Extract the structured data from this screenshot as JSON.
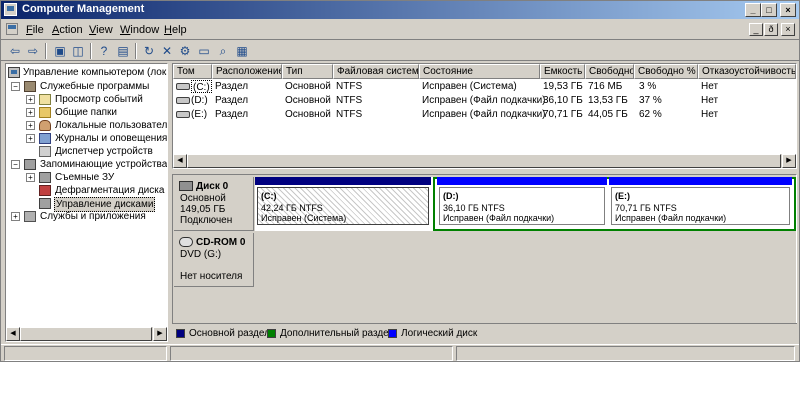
{
  "window": {
    "title": "Computer Management",
    "controls": {
      "minimize": "_",
      "maximize": "□",
      "close": "×"
    },
    "mdi_controls": {
      "minimize": "_",
      "restore": "ð",
      "close": "×"
    }
  },
  "menu": {
    "items": [
      {
        "label": "File",
        "key": "F",
        "rest": "ile"
      },
      {
        "label": "Action",
        "key": "A",
        "rest": "ction"
      },
      {
        "label": "View",
        "key": "V",
        "rest": "iew"
      },
      {
        "label": "Window",
        "key": "W",
        "rest": "indow"
      },
      {
        "label": "Help",
        "key": "H",
        "rest": "elp"
      }
    ]
  },
  "toolbar": {
    "buttons": [
      {
        "name": "back-icon",
        "glyph": "⇦"
      },
      {
        "name": "forward-icon",
        "glyph": "⇨"
      },
      {
        "name": "up-folder-icon",
        "glyph": "▣"
      },
      {
        "name": "show-hide-tree-icon",
        "glyph": "◫"
      },
      {
        "name": "help-icon",
        "glyph": "?"
      },
      {
        "name": "properties-icon",
        "glyph": "▤"
      },
      {
        "name": "refresh-icon",
        "glyph": "↻"
      },
      {
        "name": "delete-icon",
        "glyph": "✕"
      },
      {
        "name": "settings-icon",
        "glyph": "⚙"
      },
      {
        "name": "open-folder-icon",
        "glyph": "▭"
      },
      {
        "name": "search-icon",
        "glyph": "⌕"
      },
      {
        "name": "export-icon",
        "glyph": "▦"
      }
    ]
  },
  "tree": {
    "root": "Управление компьютером (локаль",
    "items": [
      {
        "label": "Служебные программы",
        "icon": "tool-icon"
      },
      {
        "label": "Просмотр событий",
        "icon": "event-viewer-icon"
      },
      {
        "label": "Общие папки",
        "icon": "shared-folder-icon"
      },
      {
        "label": "Локальные пользователи",
        "icon": "users-icon"
      },
      {
        "label": "Журналы и оповещения пр",
        "icon": "logs-icon"
      },
      {
        "label": "Диспетчер устройств",
        "icon": "device-manager-icon"
      },
      {
        "label": "Запоминающие устройства",
        "icon": "storage-icon"
      },
      {
        "label": "Съемные ЗУ",
        "icon": "removable-storage-icon"
      },
      {
        "label": "Дефрагментация диска",
        "icon": "defrag-icon"
      },
      {
        "label": "Управление дисками",
        "icon": "disk-management-icon"
      },
      {
        "label": "Службы и приложения",
        "icon": "services-icon"
      }
    ]
  },
  "volumes": {
    "columns": [
      "Том",
      "Расположение",
      "Тип",
      "Файловая система",
      "Состояние",
      "Емкость",
      "Свободно",
      "Свободно %",
      "Отказоустойчивость"
    ],
    "rows": [
      [
        "(C:)",
        "Раздел",
        "Основной",
        "NTFS",
        "Исправен (Система)",
        "19,53 ГБ",
        "716 МБ",
        "3 %",
        "Нет"
      ],
      [
        "(D:)",
        "Раздел",
        "Основной",
        "NTFS",
        "Исправен (Файл подкачки)",
        "36,10 ГБ",
        "13,53 ГБ",
        "37 %",
        "Нет"
      ],
      [
        "(E:)",
        "Раздел",
        "Основной",
        "NTFS",
        "Исправен (Файл подкачки)",
        "70,71 ГБ",
        "44,05 ГБ",
        "62 %",
        "Нет"
      ]
    ]
  },
  "disks": {
    "disk0": {
      "name": "Диск 0",
      "type": "Основной",
      "size": "149,05 ГБ",
      "status": "Подключен",
      "partitions": [
        {
          "label": "(C:)",
          "size": "42,24 ГБ NTFS",
          "status": "Исправен (Система)"
        },
        {
          "label": "(D:)",
          "size": "36,10 ГБ NTFS",
          "status": "Исправен (Файл подкачки)"
        },
        {
          "label": "(E:)",
          "size": "70,71 ГБ NTFS",
          "status": "Исправен (Файл подкачки)"
        }
      ]
    },
    "cdrom0": {
      "name": "CD-ROM 0",
      "type": "DVD (G:)",
      "status": "Нет носителя"
    }
  },
  "legend": {
    "items": [
      {
        "label": "Основной раздел",
        "color": "#000080"
      },
      {
        "label": "Дополнительный раздел",
        "color": "#008000"
      },
      {
        "label": "Логический диск",
        "color": "#0000ff"
      }
    ]
  },
  "colors": {
    "primary_partition": "#000080",
    "extended_partition": "#008000",
    "logical_drive": "#0000ff",
    "titlebar_start": "#0a246a",
    "titlebar_end": "#a6caf0"
  }
}
